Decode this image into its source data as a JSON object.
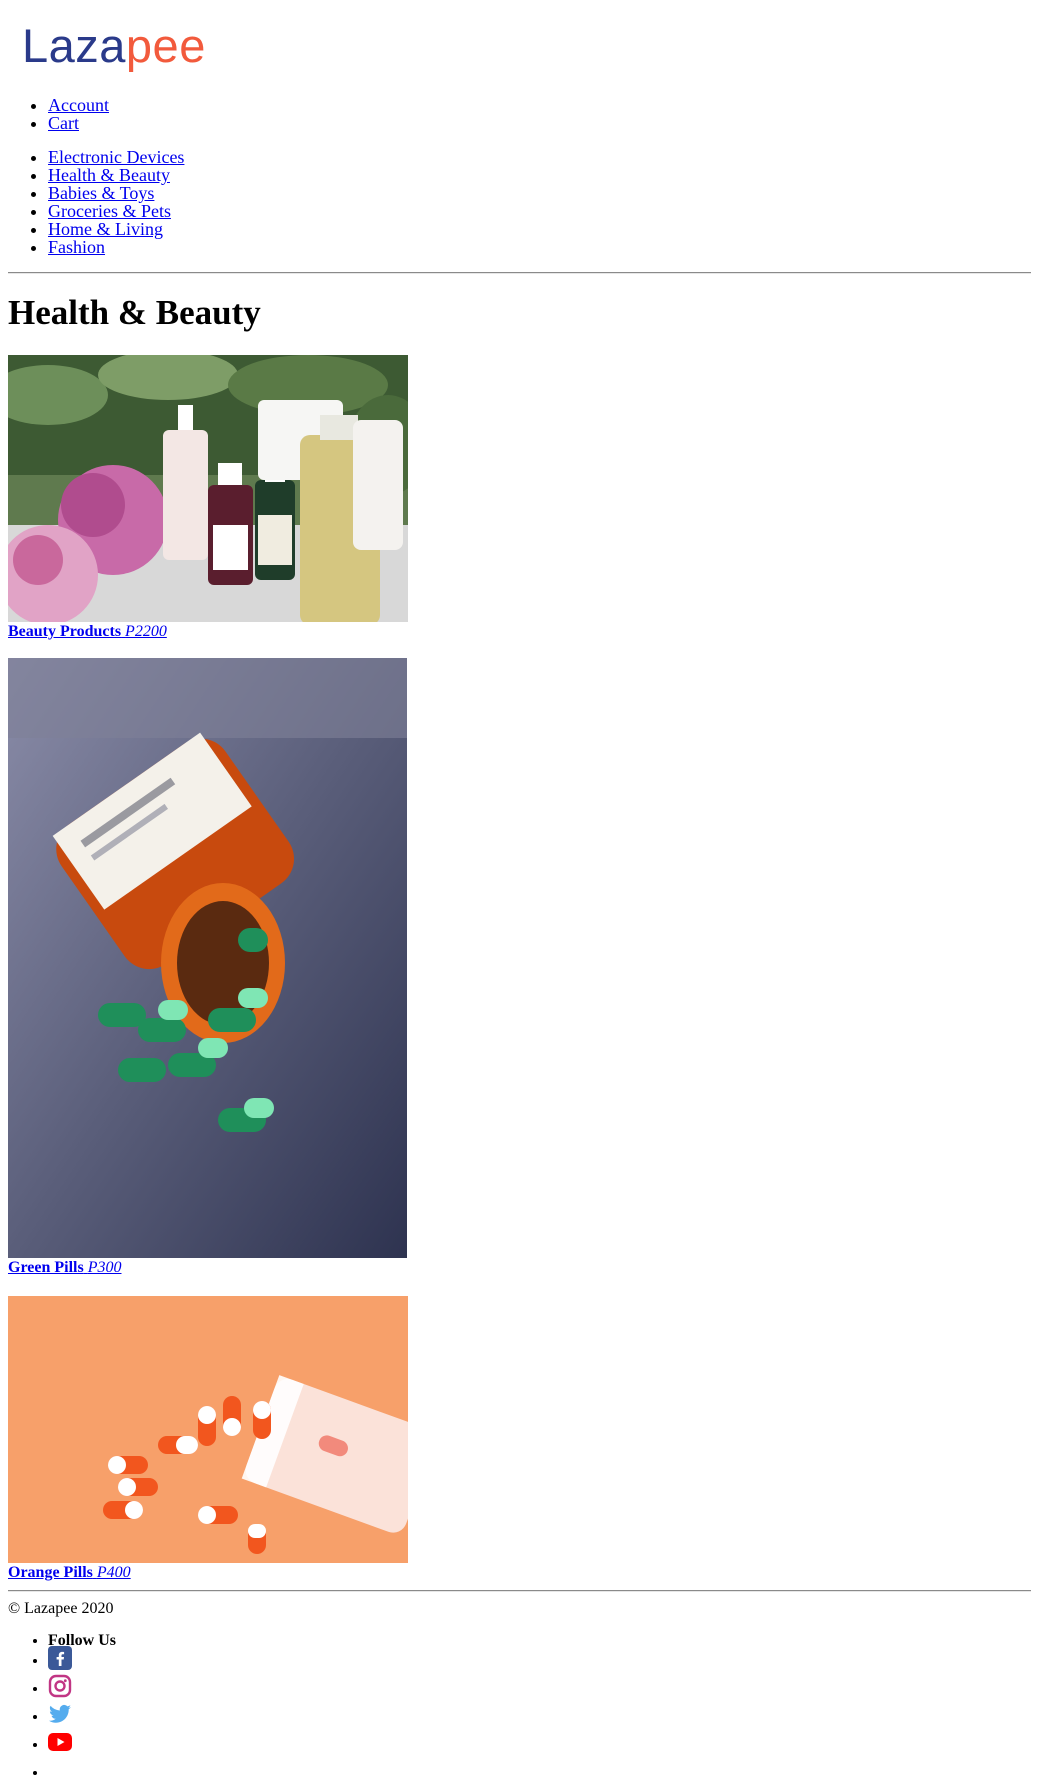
{
  "brand": {
    "part1": "Laza",
    "part2": "pee",
    "color1": "#2a3a8a",
    "color2": "#f25a3c"
  },
  "top_nav": [
    {
      "label": "Account"
    },
    {
      "label": "Cart"
    }
  ],
  "categories": [
    {
      "label": "Electronic Devices"
    },
    {
      "label": "Health & Beauty"
    },
    {
      "label": "Babies & Toys"
    },
    {
      "label": "Groceries & Pets"
    },
    {
      "label": "Home & Living"
    },
    {
      "label": "Fashion"
    }
  ],
  "page": {
    "title": "Health & Beauty"
  },
  "products": [
    {
      "name": "Beauty Products",
      "price": "P2200",
      "image": "beauty-products-photo"
    },
    {
      "name": "Green Pills",
      "price": "P300",
      "image": "green-pills-photo"
    },
    {
      "name": "Orange Pills",
      "price": "P400",
      "image": "orange-pills-photo"
    }
  ],
  "footer": {
    "copyright": "© Lazapee 2020",
    "follow_label": "Follow Us",
    "social": [
      {
        "icon": "facebook-icon",
        "color": "#3b5998"
      },
      {
        "icon": "instagram-icon",
        "color": "#c13584"
      },
      {
        "icon": "twitter-icon",
        "color": "#55acee"
      },
      {
        "icon": "youtube-icon",
        "color": "#ff0000"
      }
    ]
  }
}
